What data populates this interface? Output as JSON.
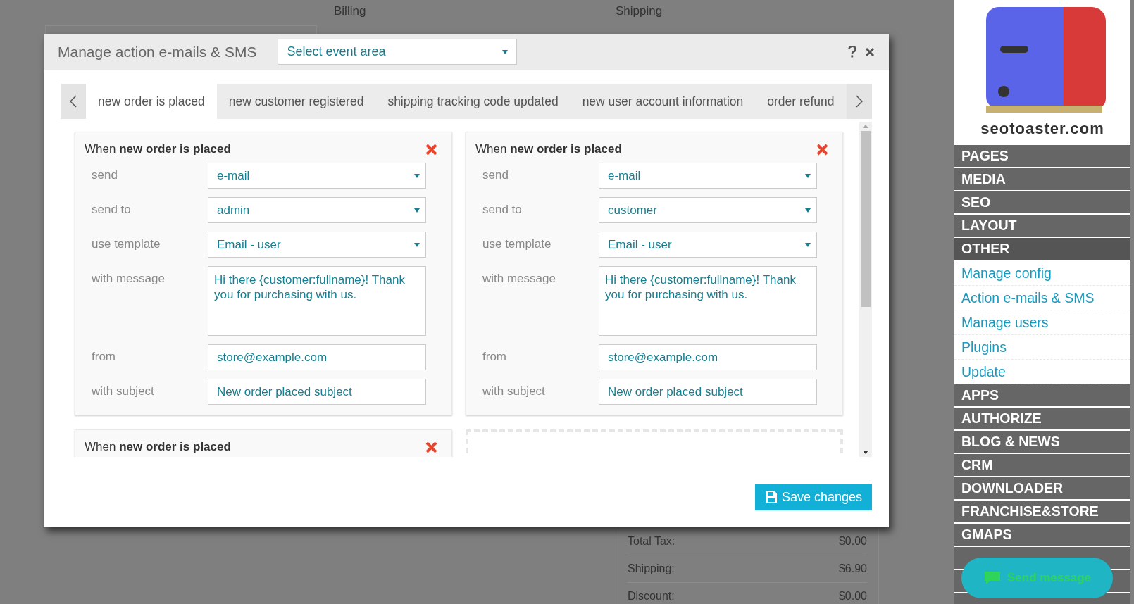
{
  "background_page": {
    "columns": [
      "Billing",
      "Shipping"
    ],
    "totals": [
      {
        "label": "Total Tax:",
        "value": "$0.00"
      },
      {
        "label": "Shipping:",
        "value": "$6.90"
      },
      {
        "label": "Discount:",
        "value": "$0.00"
      }
    ]
  },
  "dialog": {
    "title": "Manage action e-mails & SMS",
    "event_area": {
      "value": "Select event area"
    },
    "tabs": [
      {
        "label": "new order is placed",
        "selected": true
      },
      {
        "label": "new customer registered",
        "selected": false
      },
      {
        "label": "shipping tracking code updated",
        "selected": false
      },
      {
        "label": "new user account information",
        "selected": false
      },
      {
        "label": "order refund",
        "selected": false
      }
    ],
    "cards": [
      {
        "heading": "When **new order is placed**",
        "fields": [
          {
            "label": "send",
            "kind": "select",
            "value": "e-mail"
          },
          {
            "label": "send to",
            "kind": "select",
            "value": "admin"
          },
          {
            "label": "use template",
            "kind": "select",
            "value": "Email - user"
          },
          {
            "label": "with message",
            "kind": "textarea",
            "value": "Hi there {customer:fullname}! Thank you for purchasing with us."
          },
          {
            "label": "from",
            "kind": "text",
            "value": "store@example.com"
          },
          {
            "label": "with subject",
            "kind": "text",
            "value": "New order placed subject"
          }
        ]
      },
      {
        "heading": "When **new order is placed**",
        "fields": [
          {
            "label": "send",
            "kind": "select",
            "value": "e-mail"
          },
          {
            "label": "send to",
            "kind": "select",
            "value": "customer"
          },
          {
            "label": "use template",
            "kind": "select",
            "value": "Email - user"
          },
          {
            "label": "with message",
            "kind": "textarea",
            "value": "Hi there {customer:fullname}! Thank you for purchasing with us."
          },
          {
            "label": "from",
            "kind": "text",
            "value": "store@example.com"
          },
          {
            "label": "with subject",
            "kind": "text",
            "value": "New order placed subject"
          }
        ]
      },
      {
        "heading": "When **new order is placed**"
      }
    ],
    "save_button": "Save changes"
  },
  "sidebar": {
    "logo_text": "seotoaster.com",
    "menu": [
      {
        "label": "PAGES",
        "expanded": false
      },
      {
        "label": "MEDIA",
        "expanded": false
      },
      {
        "label": "SEO",
        "expanded": false
      },
      {
        "label": "LAYOUT",
        "expanded": false
      },
      {
        "label": "OTHER",
        "expanded": true,
        "children": [
          "Manage config",
          "Action e-mails & SMS",
          "Manage users",
          "Plugins",
          "Update"
        ]
      },
      {
        "label": "APPS",
        "expanded": false
      },
      {
        "label": "AUTHORIZE",
        "expanded": false
      },
      {
        "label": "BLOG & NEWS",
        "expanded": false
      },
      {
        "label": "CRM",
        "expanded": false
      },
      {
        "label": "DOWNLOADER",
        "expanded": false
      },
      {
        "label": "FRANCHISE&STORE",
        "expanded": false
      },
      {
        "label": "GMAPS",
        "expanded": false
      }
    ]
  },
  "chat_widget": {
    "label": "Send message"
  }
}
